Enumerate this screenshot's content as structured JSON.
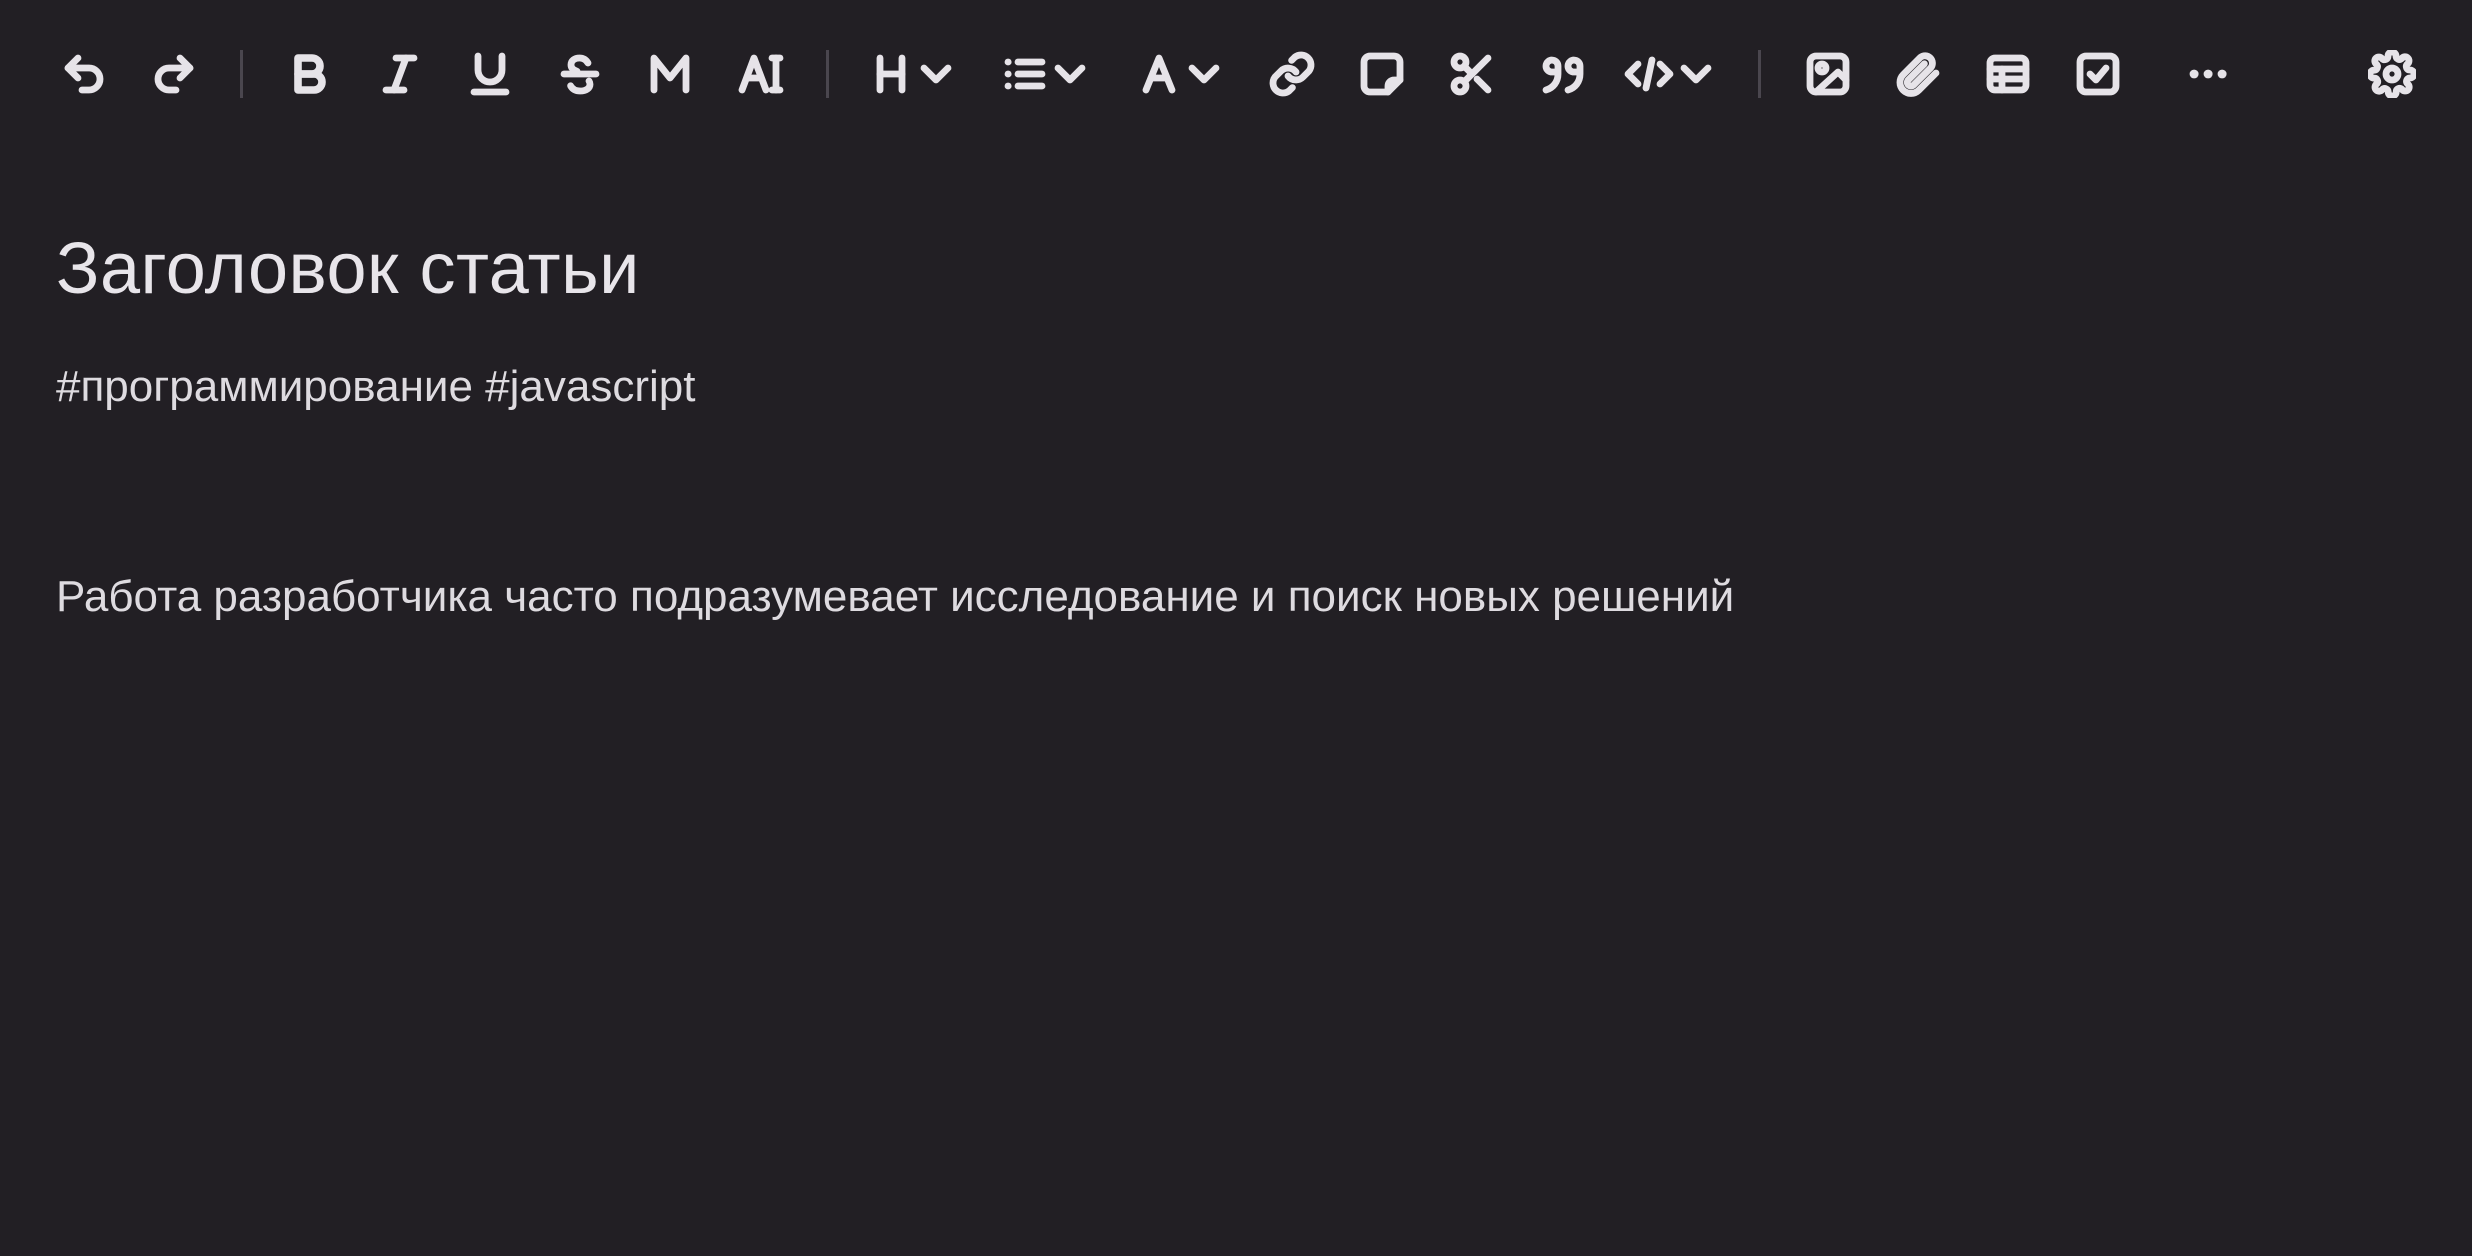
{
  "toolbar": {
    "buttons": [
      {
        "name": "undo",
        "icon": "undo-icon"
      },
      {
        "name": "redo",
        "icon": "redo-icon"
      },
      {
        "name": "bold",
        "icon": "bold-icon"
      },
      {
        "name": "italic",
        "icon": "italic-icon"
      },
      {
        "name": "underline",
        "icon": "underline-icon"
      },
      {
        "name": "strikethrough",
        "icon": "strikethrough-icon"
      },
      {
        "name": "highlight",
        "icon": "highlight-m-icon"
      },
      {
        "name": "clear-format",
        "icon": "text-cursor-icon"
      },
      {
        "name": "heading",
        "icon": "heading-dropdown-icon"
      },
      {
        "name": "list",
        "icon": "list-dropdown-icon"
      },
      {
        "name": "text-color",
        "icon": "font-color-dropdown-icon"
      },
      {
        "name": "link",
        "icon": "link-icon"
      },
      {
        "name": "sticky-note",
        "icon": "sticky-note-icon"
      },
      {
        "name": "cut",
        "icon": "scissors-icon"
      },
      {
        "name": "quote",
        "icon": "quote-icon"
      },
      {
        "name": "code",
        "icon": "code-dropdown-icon"
      },
      {
        "name": "image",
        "icon": "image-icon"
      },
      {
        "name": "attachment",
        "icon": "paperclip-icon"
      },
      {
        "name": "table",
        "icon": "table-icon"
      },
      {
        "name": "checklist",
        "icon": "checkbox-icon"
      },
      {
        "name": "more",
        "icon": "more-horizontal-icon"
      },
      {
        "name": "settings",
        "icon": "gear-icon"
      }
    ],
    "colors": {
      "icon": "#e6e3e8",
      "separator": "#4a464e",
      "background": "#221f24"
    }
  },
  "document": {
    "title": "Заголовок статьи",
    "tags": "#программирование #javascript",
    "paragraph": "Работа разработчика часто подразумевает исследование и поиск новых решений"
  }
}
